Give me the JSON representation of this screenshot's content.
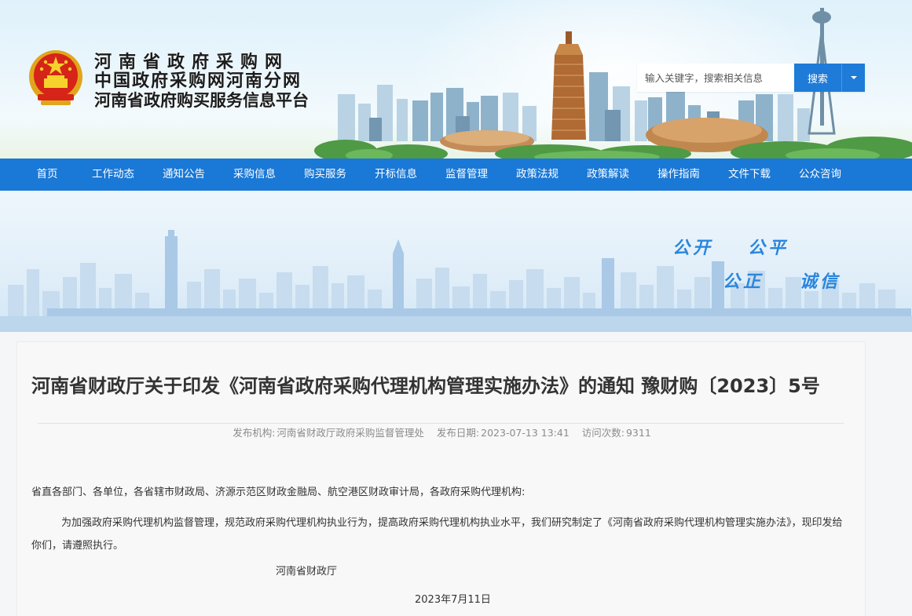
{
  "header": {
    "titles": [
      "河南省政府采购网",
      "中国政府采购网河南分网",
      "河南省政府购买服务信息平台"
    ],
    "emblem_icon": "national-emblem-icon"
  },
  "search": {
    "placeholder": "输入关键字，搜索相关信息",
    "button_label": "搜索",
    "dropdown_icon": "caret-down-icon"
  },
  "nav": {
    "items": [
      "首页",
      "工作动态",
      "通知公告",
      "采购信息",
      "购买服务",
      "开标信息",
      "监督管理",
      "政策法规",
      "政策解读",
      "操作指南",
      "文件下载",
      "公众咨询"
    ]
  },
  "slogans": [
    "公开",
    "公平",
    "公正",
    "诚信"
  ],
  "article": {
    "title": "河南省财政厅关于印发《河南省政府采购代理机构管理实施办法》的通知 豫财购〔2023〕5号",
    "meta": {
      "publisher_label": "发布机构:",
      "publisher": "河南省财政厅政府采购监督管理处",
      "date_label": "发布日期:",
      "date": "2023-07-13 13:41",
      "views_label": "访问次数:",
      "views": "9311"
    },
    "salutation": "省直各部门、各单位，各省辖市财政局、济源示范区财政金融局、航空港区财政审计局，各政府采购代理机构:",
    "paragraph": "为加强政府采购代理机构监督管理，规范政府采购代理机构执业行为，提高政府采购代理机构执业水平，我们研究制定了《河南省政府采购代理机构管理实施办法》，现印发给你们，请遵照执行。",
    "signature_org": "河南省财政厅",
    "signature_date": "2023年7月11日"
  },
  "colors": {
    "nav_bg": "#1a78d6",
    "search_btn": "#1f7bd8",
    "slogan": "#2a86dd"
  }
}
